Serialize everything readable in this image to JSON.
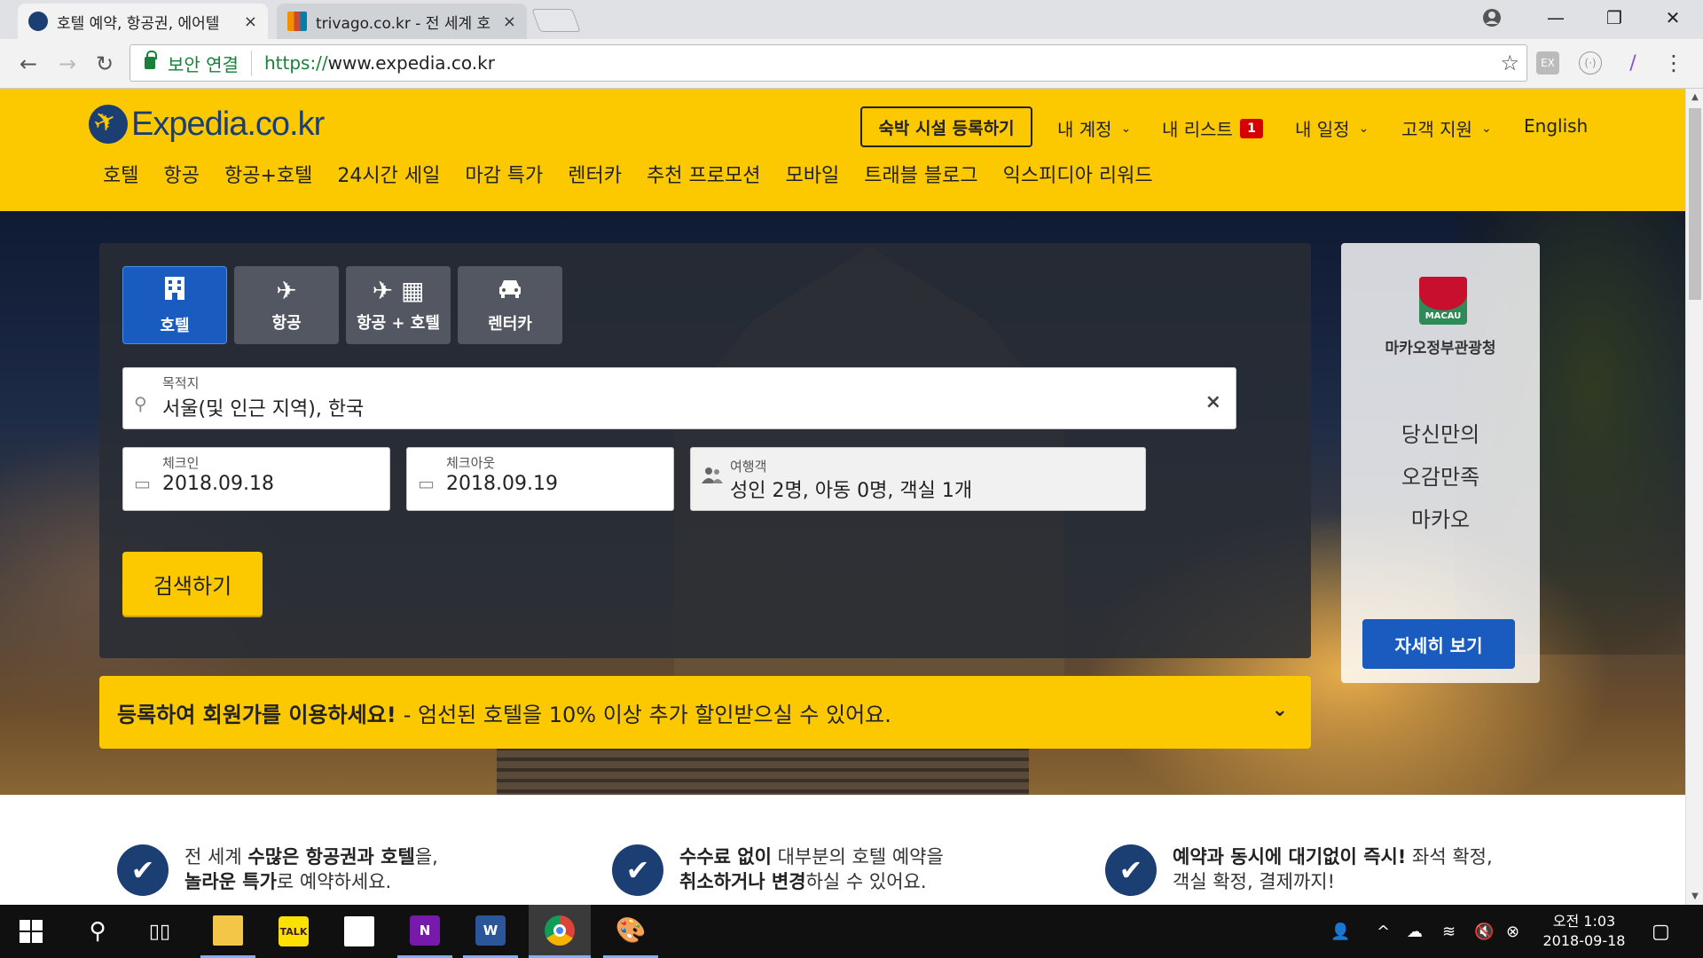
{
  "browser": {
    "tabs": [
      {
        "title": "호텔 예약, 항공권, 에어텔",
        "active": true
      },
      {
        "title": "trivago.co.kr - 전 세계 호",
        "active": false
      }
    ],
    "tab_close": "×",
    "window_controls": {
      "minimize": "—",
      "maximize": "❐",
      "close": "✕"
    },
    "back": "←",
    "forward": "→",
    "reload": "↻",
    "security_label": "보안 연결",
    "url_scheme": "https://",
    "url_host": "www.expedia.co.kr",
    "bookmark_star": "☆",
    "menu": "⋮",
    "extensions": [
      "EX",
      "(·)",
      "/"
    ]
  },
  "site": {
    "logo_text": "Expedia.co.kr",
    "register_property": "숙박 시설 등록하기",
    "account_nav": [
      {
        "label": "내 계정"
      },
      {
        "label": "내 리스트",
        "badge": "1"
      },
      {
        "label": "내 일정"
      },
      {
        "label": "고객 지원"
      },
      {
        "label": "English"
      }
    ],
    "main_nav": [
      "호텔",
      "항공",
      "항공+호텔",
      "24시간 세일",
      "마감 특가",
      "렌터카",
      "추천 프로모션",
      "모바일",
      "트래블 블로그",
      "익스피디아 리워드"
    ]
  },
  "search": {
    "tabs": [
      {
        "label": "호텔",
        "icon": "building-icon",
        "active": true
      },
      {
        "label": "항공",
        "icon": "plane-icon",
        "active": false
      },
      {
        "label": "항공 + 호텔",
        "icon": "plane-building-icon",
        "active": false
      },
      {
        "label": "렌터카",
        "icon": "car-icon",
        "active": false
      }
    ],
    "destination": {
      "label": "목적지",
      "value": "서울(및 인근 지역), 한국",
      "clear": "×"
    },
    "checkin": {
      "label": "체크인",
      "value": "2018.09.18"
    },
    "checkout": {
      "label": "체크아웃",
      "value": "2018.09.19"
    },
    "travelers": {
      "label": "여행객",
      "value": "성인 2명, 아동 0명, 객실 1개"
    },
    "submit": "검색하기"
  },
  "promo": {
    "bold": "등록하여 회원가를 이용하세요!",
    "text": "- 엄선된 호텔을 10% 이상 추가 할인받으실 수 있어요.",
    "chevron": "⌄"
  },
  "ad": {
    "logo_text": "MACAU",
    "org": "마카오정부관광청",
    "lines": [
      "당신만의",
      "오감만족",
      "마카오"
    ],
    "button": "자세히 보기"
  },
  "features": [
    {
      "line1_parts": [
        "전 세계 ",
        "수많은 항공권과 호텔",
        "을,"
      ],
      "line2_parts": [
        "놀라운 특가",
        "로 예약하세요."
      ]
    },
    {
      "line1_parts": [
        "수수료 없이",
        " 대부분의 호텔 예약을"
      ],
      "line2_parts": [
        "취소하거나 변경",
        "하실 수 있어요."
      ]
    },
    {
      "line1_parts": [
        "예약과 동시에 대기없이 즉시!",
        " 좌석 확정,"
      ],
      "line2_parts": [
        "객실 확정, 결제까지!"
      ]
    }
  ],
  "taskbar": {
    "apps": [
      "windows-start",
      "search",
      "task-view",
      "file-explorer",
      "kakaotalk",
      "sticky-notes",
      "onenote",
      "word",
      "chrome",
      "paint"
    ],
    "kakaotalk_label": "TALK",
    "onenote_label": "N",
    "word_label": "W",
    "clock_time": "오전 1:03",
    "clock_date": "2018-09-18"
  },
  "colors": {
    "brand_yellow": "#fcc900",
    "brand_navy": "#1b3f73",
    "cta_blue": "#1a5bbf",
    "badge_red": "#d60000"
  }
}
